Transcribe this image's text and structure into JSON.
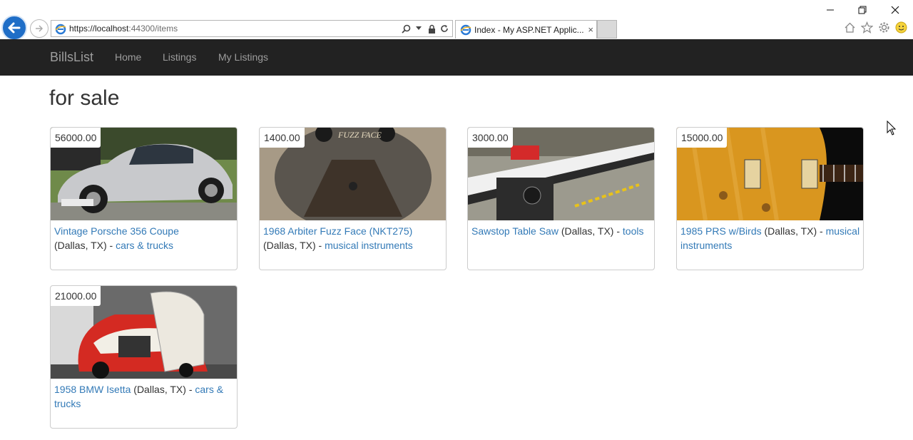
{
  "browser": {
    "url_prefix": "https://localhost",
    "url_rest": ":44300/items",
    "tab_title": "Index - My ASP.NET Applic...",
    "tab_close": "×"
  },
  "navbar": {
    "brand": "BillsList",
    "links": [
      "Home",
      "Listings",
      "My Listings"
    ]
  },
  "page": {
    "heading": "for sale"
  },
  "listings": [
    {
      "price": "56000.00",
      "title": "Vintage Porsche 356 Coupe",
      "location": "(Dallas, TX) - ",
      "category": "cars & trucks"
    },
    {
      "price": "1400.00",
      "title": "1968 Arbiter Fuzz Face (NKT275)",
      "location": "(Dallas, TX) - ",
      "category": "musical instruments"
    },
    {
      "price": "3000.00",
      "title": "Sawstop Table Saw",
      "location": " (Dallas, TX) - ",
      "category": "tools"
    },
    {
      "price": "15000.00",
      "title": "1985 PRS w/Birds",
      "location": " (Dallas, TX) - ",
      "category": "musical instruments"
    },
    {
      "price": "21000.00",
      "title": "1958 BMW Isetta",
      "location": " (Dallas, TX) - ",
      "category": "cars & trucks"
    }
  ],
  "colors": {
    "navbar_bg": "#222222",
    "link": "#337ab7",
    "ie_blue": "#1f6ec7"
  }
}
